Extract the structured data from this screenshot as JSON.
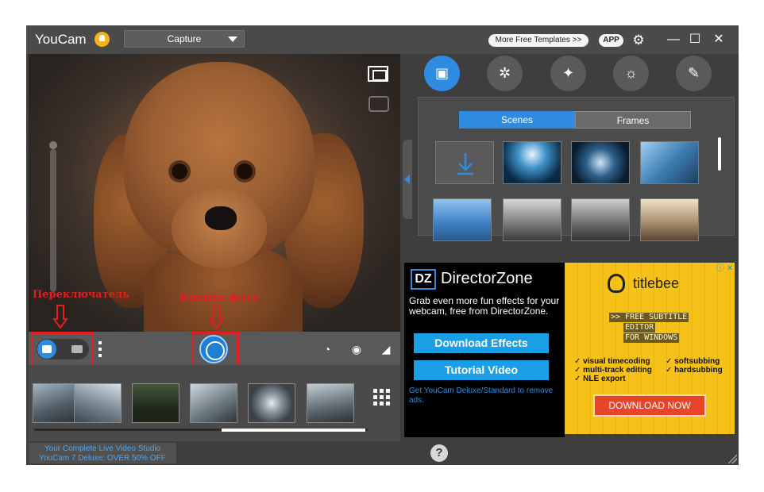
{
  "app": {
    "title": "YouCam",
    "mode": "Capture",
    "more_templates": "More Free Templates  >>",
    "app_label": "APP"
  },
  "annotations": {
    "switch_label": "Переключатель",
    "photo_button_label": "Кнопка фото",
    "color": "#e02020"
  },
  "effects": {
    "tabs": [
      {
        "icon": "scenes-icon",
        "active": true
      },
      {
        "icon": "particles-icon",
        "active": false
      },
      {
        "icon": "magic-wand-icon",
        "active": false
      },
      {
        "icon": "face-effects-icon",
        "active": false
      },
      {
        "icon": "draw-icon",
        "active": false
      }
    ],
    "segments": {
      "scenes": "Scenes",
      "frames": "Frames"
    }
  },
  "ad": {
    "brand": "DirectorZone",
    "logo": "DZ",
    "text": "Grab even more fun effects for your webcam, free from DirectorZone.",
    "download_effects": "Download Effects",
    "tutorial_video": "Tutorial Video",
    "link": "Get YouCam Deluxe/Standard to remove ads."
  },
  "ad2": {
    "brand": "titlebee",
    "lines": [
      ">> FREE SUBTITLE",
      "EDITOR",
      "FOR WINDOWS"
    ],
    "features_left": [
      "visual timecoding",
      "multi-track editing",
      "NLE export"
    ],
    "features_right": [
      "softsubbing",
      "hardsubbing"
    ],
    "cta": "DOWNLOAD NOW"
  },
  "bottom": {
    "promo_line1": "Your Complete Live Video Studio",
    "promo_line2": "YouCam 7 Deluxe: OVER 50% OFF",
    "help": "?"
  },
  "colors": {
    "accent": "#2f8be0",
    "window_bg": "#3e3e3e"
  }
}
